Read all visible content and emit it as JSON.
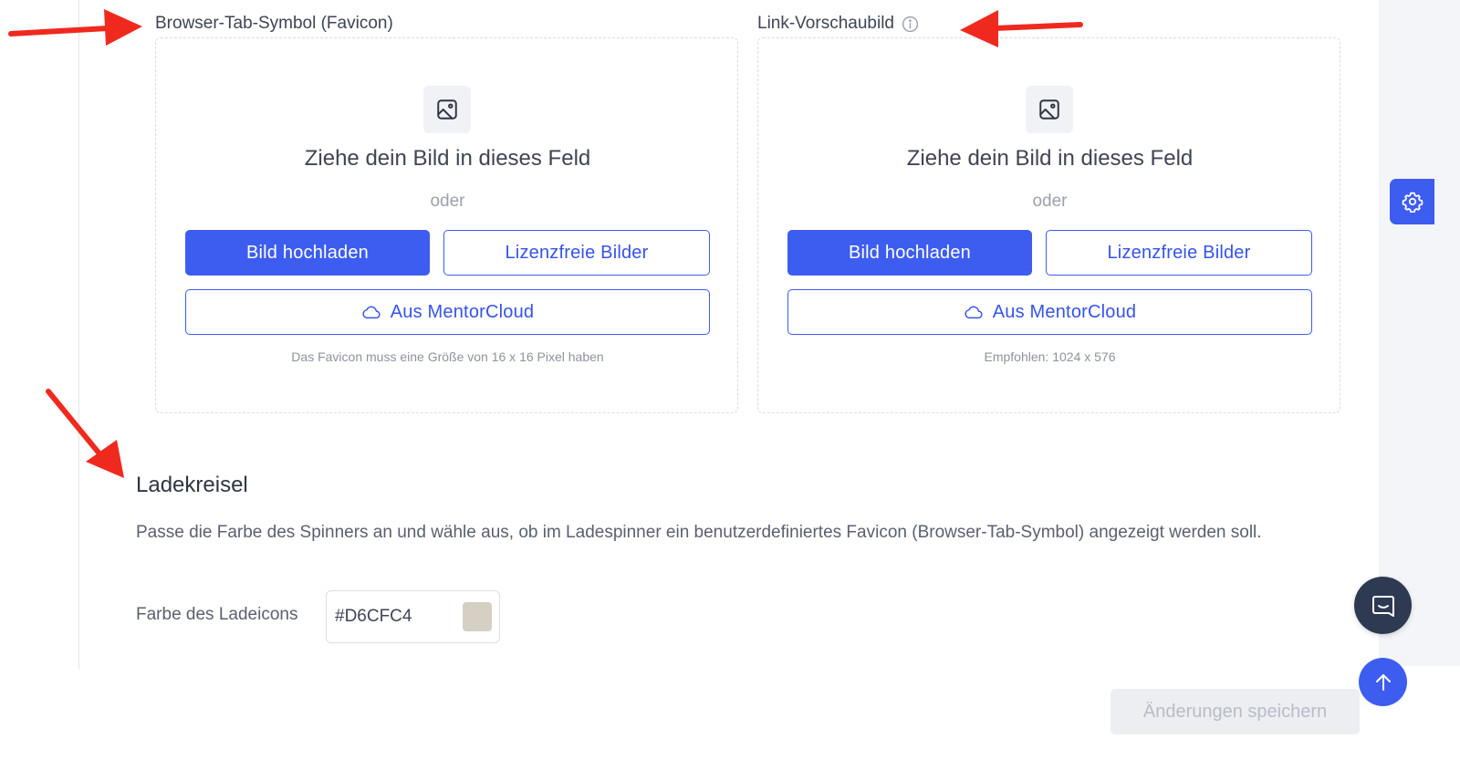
{
  "favicon": {
    "label": "Browser-Tab-Symbol (Favicon)",
    "drop_title": "Ziehe dein Bild in dieses Feld",
    "or_text": "oder",
    "upload_label": "Bild hochladen",
    "stock_label": "Lizenzfreie Bilder",
    "cloud_label": "Aus MentorCloud",
    "hint": "Das Favicon muss eine Größe von 16 x 16 Pixel haben"
  },
  "link_preview": {
    "label": "Link-Vorschaubild",
    "drop_title": "Ziehe dein Bild in dieses Feld",
    "or_text": "oder",
    "upload_label": "Bild hochladen",
    "stock_label": "Lizenzfreie Bilder",
    "cloud_label": "Aus MentorCloud",
    "hint": "Empfohlen: 1024 x 576"
  },
  "spinner": {
    "title": "Ladekreisel",
    "description": "Passe die Farbe des Spinners an und wähle aus, ob im Ladespinner ein benutzerdefiniertes Favicon (Browser-Tab-Symbol) angezeigt werden soll.",
    "color_label": "Farbe des Ladeicons",
    "color_value": "#D6CFC4"
  },
  "footer": {
    "save_label": "Änderungen speichern"
  },
  "colors": {
    "accent": "#3D5CF0",
    "annotation_arrow": "#F0291F",
    "chat_button": "#2E3A52",
    "swatch": "#D6CFC4"
  },
  "icons": {
    "image": "image-icon",
    "info": "info-icon",
    "cloud": "cloud-icon",
    "settings": "gear-icon",
    "chat": "chat-icon",
    "scroll_top": "arrow-up-icon"
  }
}
